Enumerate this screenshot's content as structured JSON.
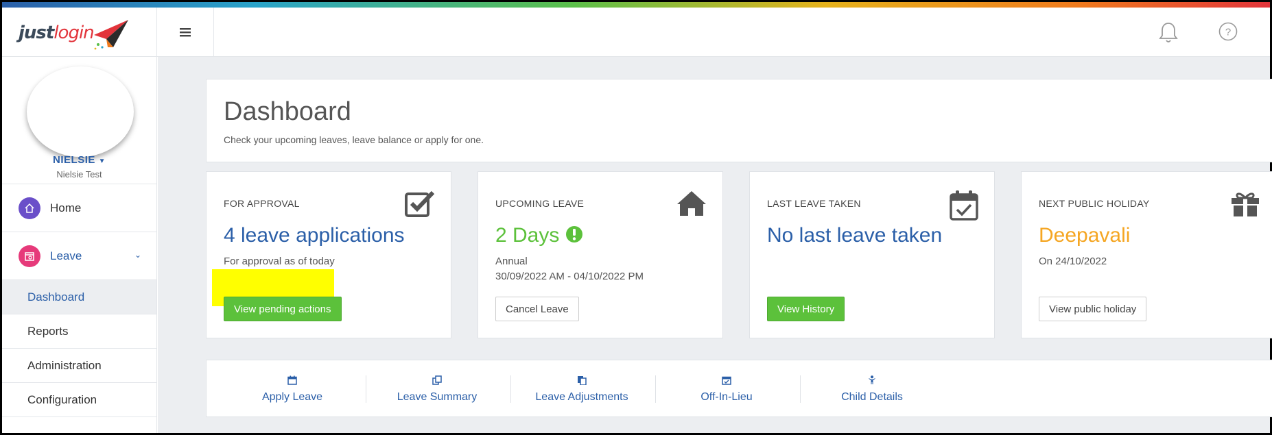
{
  "app": {
    "logo_just": "just",
    "logo_login": "login"
  },
  "user": {
    "name": "NIELSIE",
    "fullname": "Nielsie Test"
  },
  "sidebar": {
    "items": [
      {
        "label": "Home",
        "icon": "home-icon"
      },
      {
        "label": "Leave",
        "icon": "leave-calendar-icon"
      }
    ],
    "subitems": [
      {
        "label": "Dashboard"
      },
      {
        "label": "Reports"
      },
      {
        "label": "Administration"
      },
      {
        "label": "Configuration"
      }
    ]
  },
  "header": {
    "title": "Dashboard",
    "subtitle": "Check your upcoming leaves, leave balance or apply for one."
  },
  "cards": [
    {
      "heading": "FOR APPROVAL",
      "value": "4 leave applications",
      "line1": "For approval as of today",
      "button": "View pending actions",
      "icon": "check-square-icon"
    },
    {
      "heading": "UPCOMING LEAVE",
      "value": "2 Days",
      "line1": "Annual",
      "line2": "30/09/2022 AM - 04/10/2022 PM",
      "button": "Cancel Leave",
      "icon": "house-icon"
    },
    {
      "heading": "LAST LEAVE TAKEN",
      "value": "No last leave taken",
      "button": "View History",
      "icon": "calendar-check-icon"
    },
    {
      "heading": "NEXT PUBLIC HOLIDAY",
      "value": "Deepavali",
      "line1": "On 24/10/2022",
      "button": "View public holiday",
      "icon": "gift-icon"
    }
  ],
  "quick_links": [
    {
      "label": "Apply Leave",
      "icon": "calendar-icon"
    },
    {
      "label": "Leave Summary",
      "icon": "copy-icon"
    },
    {
      "label": "Leave Adjustments",
      "icon": "files-icon"
    },
    {
      "label": "Off-In-Lieu",
      "icon": "calendar-check-icon"
    },
    {
      "label": "Child Details",
      "icon": "child-icon"
    }
  ],
  "colors": {
    "brand_blue": "#2b5fa8",
    "green": "#5cc13b",
    "orange": "#f5a623",
    "highlight": "#ffff00"
  }
}
